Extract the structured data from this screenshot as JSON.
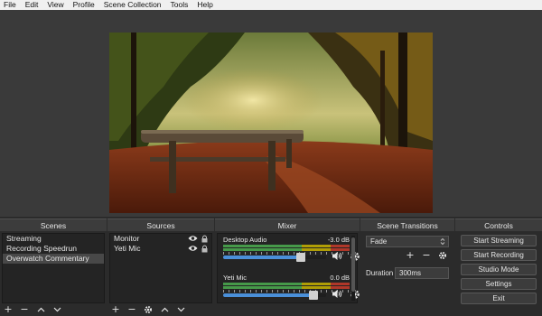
{
  "menu": [
    "File",
    "Edit",
    "View",
    "Profile",
    "Scene Collection",
    "Tools",
    "Help"
  ],
  "docks": {
    "scenes_title": "Scenes",
    "sources_title": "Sources",
    "mixer_title": "Mixer",
    "transitions_title": "Scene Transitions",
    "controls_title": "Controls"
  },
  "scenes": [
    {
      "label": "Streaming",
      "selected": false
    },
    {
      "label": "Recording Speedrun",
      "selected": false
    },
    {
      "label": "Overwatch Commentary",
      "selected": true
    }
  ],
  "sources": [
    {
      "label": "Monitor"
    },
    {
      "label": "Yeti Mic"
    }
  ],
  "mixer": [
    {
      "name": "Desktop Audio",
      "db": "-3.0 dB",
      "volume_fraction": 0.75
    },
    {
      "name": "Yeti Mic",
      "db": "0.0 dB",
      "volume_fraction": 0.88
    }
  ],
  "transitions": {
    "selected": "Fade",
    "duration_label": "Duration",
    "duration_value": "300ms"
  },
  "controls": {
    "start_streaming": "Start Streaming",
    "start_recording": "Start Recording",
    "studio_mode": "Studio Mode",
    "settings": "Settings",
    "exit": "Exit"
  },
  "icons": {
    "add": "plus-icon",
    "remove": "minus-icon",
    "up": "chevron-up-icon",
    "down": "chevron-down-icon",
    "properties": "gear-icon",
    "visibility": "eye-icon",
    "lock": "lock-icon",
    "speaker": "speaker-icon"
  },
  "colors": {
    "meter_green": "#4caf50",
    "meter_yellow": "#c8b400",
    "meter_red": "#c83a2a",
    "volume_accent": "#4a8fd8"
  }
}
